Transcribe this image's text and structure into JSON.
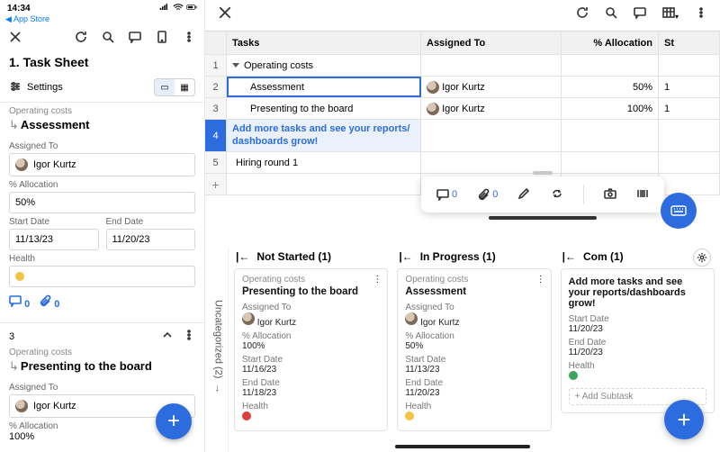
{
  "phone": {
    "time": "14:34",
    "back_link": "App Store",
    "title": "1. Task Sheet",
    "settings_label": "Settings",
    "group": "Operating costs",
    "task1": {
      "title": "Assessment",
      "assigned_label": "Assigned To",
      "assigned_value": "Igor Kurtz",
      "alloc_label": "% Allocation",
      "alloc_value": "50%",
      "start_label": "Start Date",
      "start_value": "11/13/23",
      "end_label": "End Date",
      "end_value": "11/20/23",
      "health_label": "Health",
      "comments": "0",
      "attachments": "0"
    },
    "task2": {
      "index": "3",
      "group": "Operating costs",
      "title": "Presenting to the board",
      "assigned_label": "Assigned To",
      "assigned_value": "Igor Kurtz",
      "alloc_label": "% Allocation",
      "alloc_value": "100%"
    }
  },
  "tablet": {
    "headers": {
      "tasks": "Tasks",
      "assigned": "Assigned To",
      "alloc": "% Allocation",
      "status": "St"
    },
    "rows": [
      {
        "num": "1",
        "task": "Operating costs",
        "assigned": "",
        "alloc": "",
        "parent": true
      },
      {
        "num": "2",
        "task": "Assessment",
        "assigned": "Igor Kurtz",
        "alloc": "50%",
        "selected": true,
        "status": "1"
      },
      {
        "num": "3",
        "task": "Presenting to the board",
        "assigned": "Igor Kurtz",
        "alloc": "100%",
        "status": "1"
      },
      {
        "num": "4",
        "task": "Add more tasks and see your reports/ dashboards grow!",
        "placeholder": true
      },
      {
        "num": "5",
        "task": "Hiring round 1"
      }
    ],
    "float": {
      "comments": "0",
      "attachments": "0"
    },
    "side_label": "Uncategorized (2)",
    "columns": {
      "c1": {
        "header": "Not Started (1)",
        "card": {
          "group": "Operating costs",
          "title": "Presenting to the board",
          "assigned_label": "Assigned To",
          "assigned_value": "Igor Kurtz",
          "alloc_label": "% Allocation",
          "alloc_value": "100%",
          "start_label": "Start Date",
          "start_value": "11/16/23",
          "end_label": "End Date",
          "end_value": "11/18/23",
          "health_label": "Health"
        }
      },
      "c2": {
        "header": "In Progress (1)",
        "card": {
          "group": "Operating costs",
          "title": "Assessment",
          "assigned_label": "Assigned To",
          "assigned_value": "Igor Kurtz",
          "alloc_label": "% Allocation",
          "alloc_value": "50%",
          "start_label": "Start Date",
          "start_value": "11/13/23",
          "end_label": "End Date",
          "end_value": "11/20/23",
          "health_label": "Health"
        }
      },
      "c3": {
        "header": "Com       (1)",
        "card": {
          "title": "Add more tasks and see your reports/dashboards grow!",
          "start_label": "Start Date",
          "start_value": "11/20/23",
          "end_label": "End Date",
          "end_value": "11/20/23",
          "health_label": "Health",
          "add_sub": "+ Add Subtask"
        }
      }
    }
  }
}
